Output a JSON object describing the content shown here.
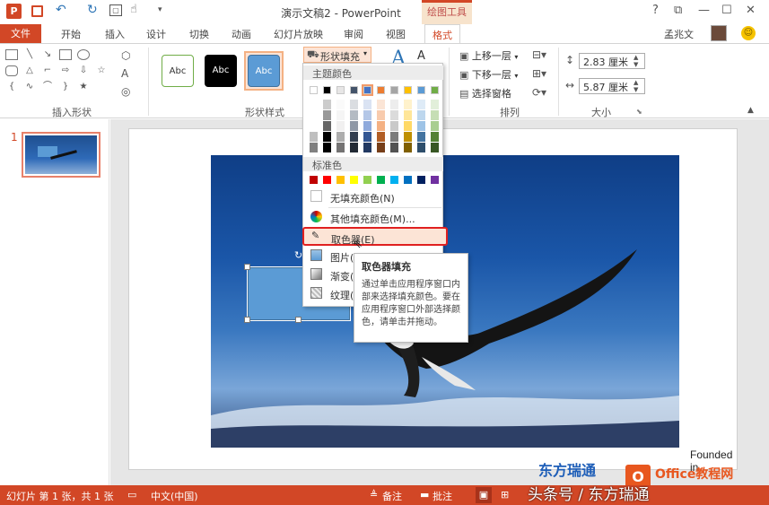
{
  "titlebar": {
    "title": "演示文稿2 - PowerPoint",
    "contextual_tab": "绘图工具",
    "help": "?",
    "restore": "⧉",
    "minimize": "—",
    "maximize": "☐",
    "close": "✕"
  },
  "tabs": {
    "file": "文件",
    "items": [
      "开始",
      "插入",
      "设计",
      "切换",
      "动画",
      "幻灯片放映",
      "审阅",
      "视图"
    ],
    "format": "格式",
    "user": "孟兆文"
  },
  "ribbon": {
    "group_insert_shapes": "插入形状",
    "group_shape_styles": "形状样式",
    "group_arrange": "排列",
    "group_size": "大小",
    "style_sample": "Abc",
    "shape_fill": "形状填充",
    "bring_forward": "上移一层",
    "send_backward": "下移一层",
    "selection_pane": "选择窗格",
    "height_value": "2.83 厘米",
    "width_value": "5.87 厘米"
  },
  "fill_menu": {
    "theme_colors_label": "主题颜色",
    "standard_colors_label": "标准色",
    "no_fill": "无填充颜色(N)",
    "more_colors": "其他填充颜色(M)...",
    "eyedropper": "取色器(E)",
    "picture": "图片(P)...",
    "gradient": "渐变(G)",
    "texture": "纹理(T)",
    "theme_top": [
      "#ffffff",
      "#000000",
      "#e7e6e6",
      "#44546a",
      "#4472c4",
      "#ed7d31",
      "#a5a5a5",
      "#ffc000",
      "#5b9bd5",
      "#70ad47"
    ],
    "standard": [
      "#c00000",
      "#ff0000",
      "#ffc000",
      "#ffff00",
      "#92d050",
      "#00b050",
      "#00b0f0",
      "#0070c0",
      "#002060",
      "#7030a0"
    ]
  },
  "tooltip": {
    "title": "取色器填充",
    "body": "通过单击应用程序窗口内部来选择填充颜色。要在应用程序窗口外部选择颜色，请单击并拖动。"
  },
  "thumbnails": {
    "number": "1"
  },
  "watermarks": {
    "founded": "Founded in",
    "brand_cn": "东方瑞通",
    "office": "Office教程网",
    "toutiao": "头条号 / 东方瑞通"
  },
  "statusbar": {
    "slide_info": "幻灯片 第 1 张，共 1 张",
    "language": "中文(中国)",
    "notes": "备注",
    "comments": "批注"
  }
}
